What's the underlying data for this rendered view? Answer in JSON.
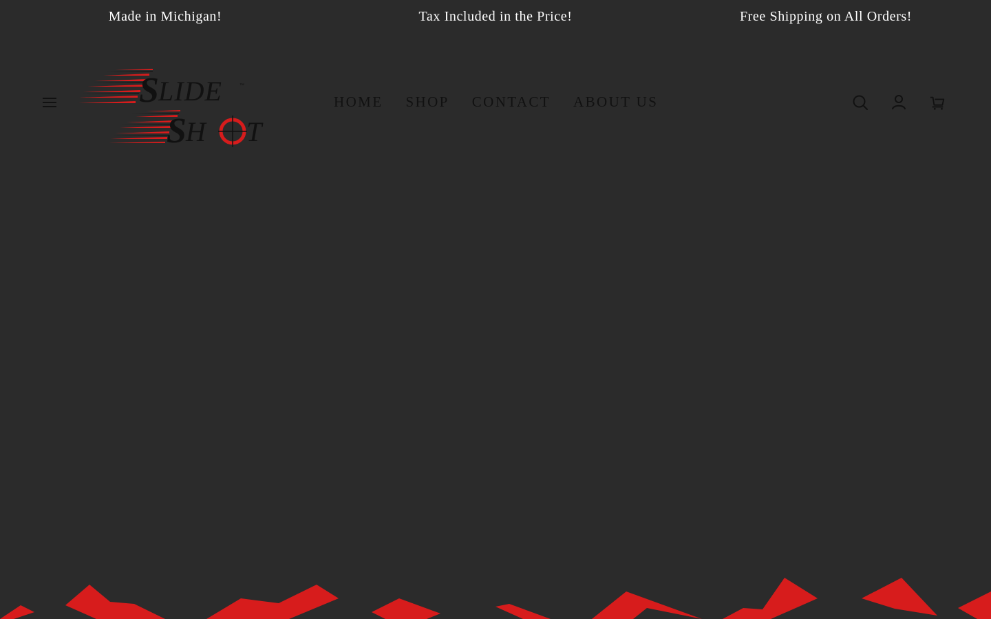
{
  "announcement": {
    "items": [
      "Made in Michigan!",
      "Tax Included in the Price!",
      "Free Shipping on All Orders!"
    ]
  },
  "header": {
    "logo_text": "Slide Shot",
    "nav": [
      "HOME",
      "SHOP",
      "CONTACT",
      "ABOUT US"
    ],
    "icons": [
      "menu-icon",
      "search-icon",
      "account-icon",
      "cart-icon"
    ]
  },
  "colors": {
    "background": "#2b2b2b",
    "announcement_text": "#ffffff",
    "nav_text": "#111111",
    "accent": "#d71c1c"
  }
}
